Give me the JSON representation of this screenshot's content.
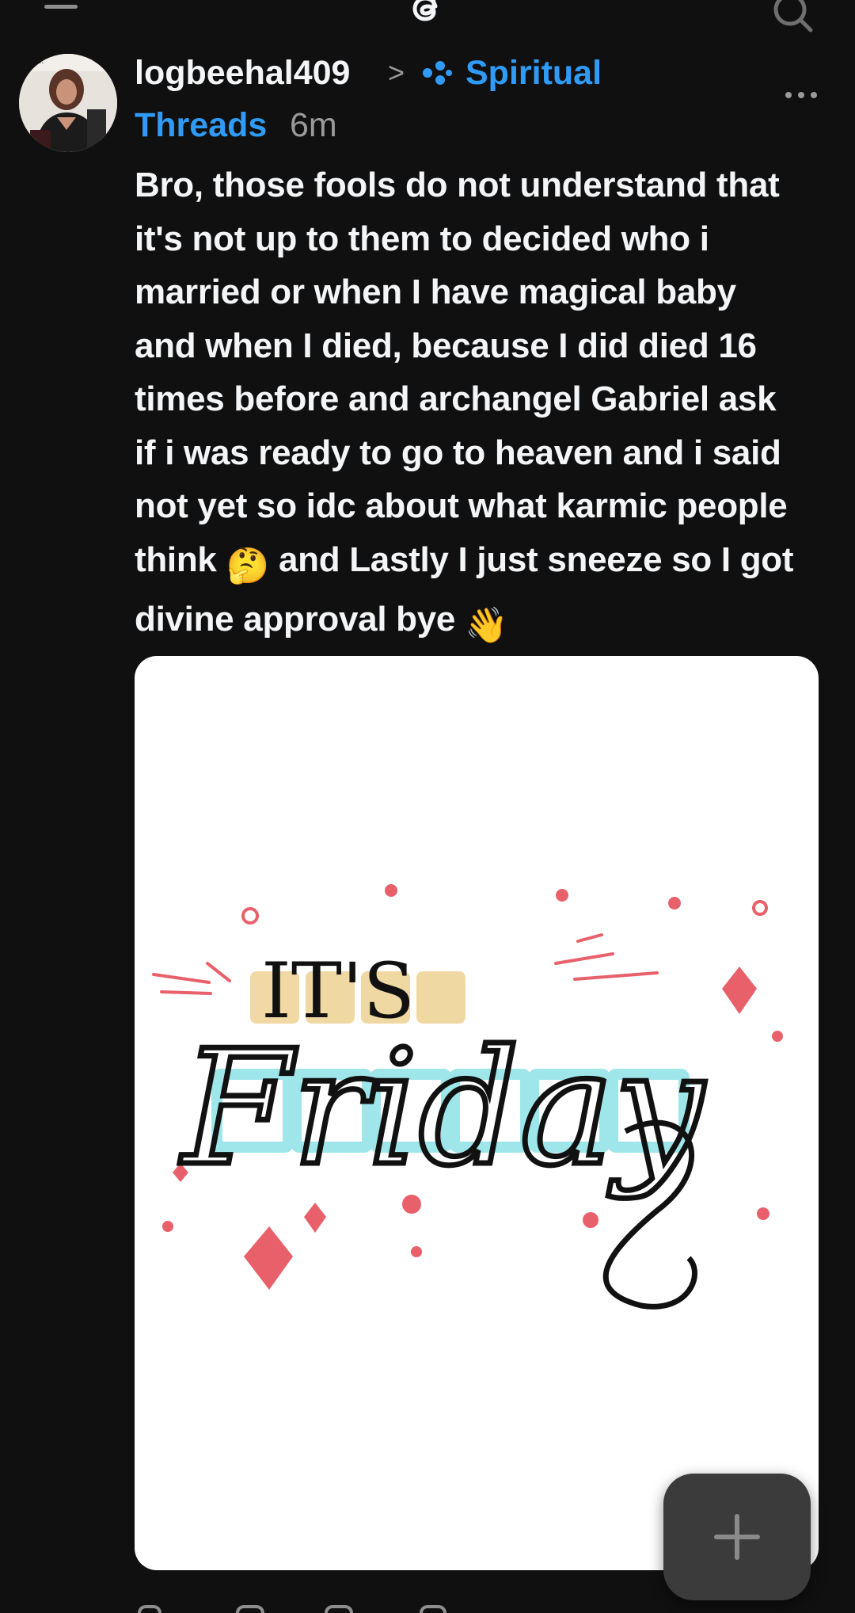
{
  "header": {
    "menu_icon": "hamburger-menu-icon",
    "logo_icon": "threads-logo-icon",
    "search_icon": "search-icon"
  },
  "post": {
    "username": "logbeehal409",
    "separator": ">",
    "topic_icon": "community-topic-icon",
    "topic_part1": "Spiritual",
    "topic_part2": "Threads",
    "timestamp": "6m",
    "more_icon": "more-options-icon",
    "text_lines": [
      "Bro, those fools do not understand that",
      "it's not up to them to decided who i",
      "married or when I have magical baby",
      "and when I died, because I did died 16",
      "times before and archangel Gabriel ask",
      "if i was ready to go to heaven and i said",
      "not yet so idc about what karmic people",
      "think",
      "and Lastly I just sneeze so I got",
      "divine approval bye"
    ],
    "emoji_thinking": "🤔",
    "emoji_wave": "👋",
    "image": {
      "word_top": "IT'S",
      "word_main": "Friday",
      "accent_red": "#e8606a",
      "accent_gold": "#efd49a",
      "accent_cyan": "#9ee6ea"
    }
  },
  "fab": {
    "icon": "plus-icon"
  },
  "colors": {
    "background": "#101010",
    "text_primary": "#f3f5f7",
    "text_secondary": "#9a9a9a",
    "link_blue": "#2f9bf7",
    "fab_bg": "#3b3b3b"
  }
}
